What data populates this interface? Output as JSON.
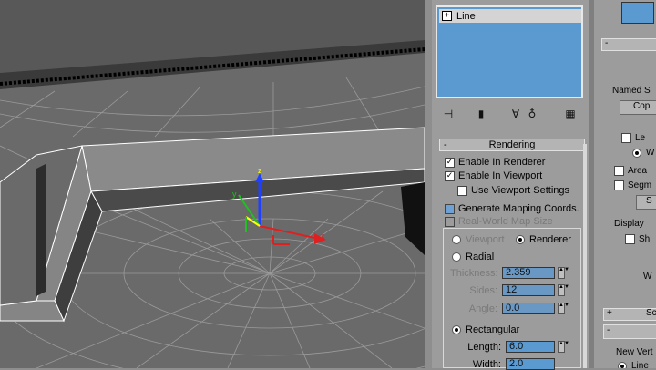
{
  "modifier_stack": {
    "items": [
      {
        "label": "Line",
        "expander": "+"
      }
    ]
  },
  "stack_tools": [
    "pin-stack-icon",
    "show-end-result-icon",
    "make-unique-icon",
    "remove-modifier-icon",
    "configure-modifier-sets-icon"
  ],
  "rendering_rollout": {
    "title": "Rendering",
    "collapse": "-",
    "enable_in_renderer": {
      "label": "Enable In Renderer",
      "checked": true
    },
    "enable_in_viewport": {
      "label": "Enable In Viewport",
      "checked": true
    },
    "use_viewport_settings": {
      "label": "Use Viewport Settings",
      "checked": false
    },
    "generate_mapping": {
      "label": "Generate Mapping Coords.",
      "checked": false
    },
    "real_world_map_size": {
      "label": "Real-World Map Size",
      "checked": false
    },
    "viewport_radio": "Viewport",
    "renderer_radio": "Renderer",
    "radial": {
      "label": "Radial",
      "thickness_label": "Thickness:",
      "thickness": "2.359",
      "sides_label": "Sides:",
      "sides": "12",
      "angle_label": "Angle:",
      "angle": "0.0"
    },
    "rectangular": {
      "label": "Rectangular",
      "length_label": "Length:",
      "length": "6.0",
      "width_label": "Width:",
      "width": "2.0"
    }
  },
  "right_panel": {
    "collapse1": "-",
    "named_sel": "Named S",
    "copy": "Cop",
    "lev": "Le",
    "w": "W",
    "area": "Area",
    "segm": "Segm",
    "s": "S",
    "display": "Display",
    "sh": "Sh",
    "w2": "W",
    "plus_label": "+",
    "sc": "Sc",
    "new_vert": "New Vert",
    "line": "Line"
  },
  "colors": {
    "accent_field": "#5b9ad0",
    "axis_x": "#e02020",
    "axis_y": "#20c020",
    "axis_z": "#2040ff"
  }
}
